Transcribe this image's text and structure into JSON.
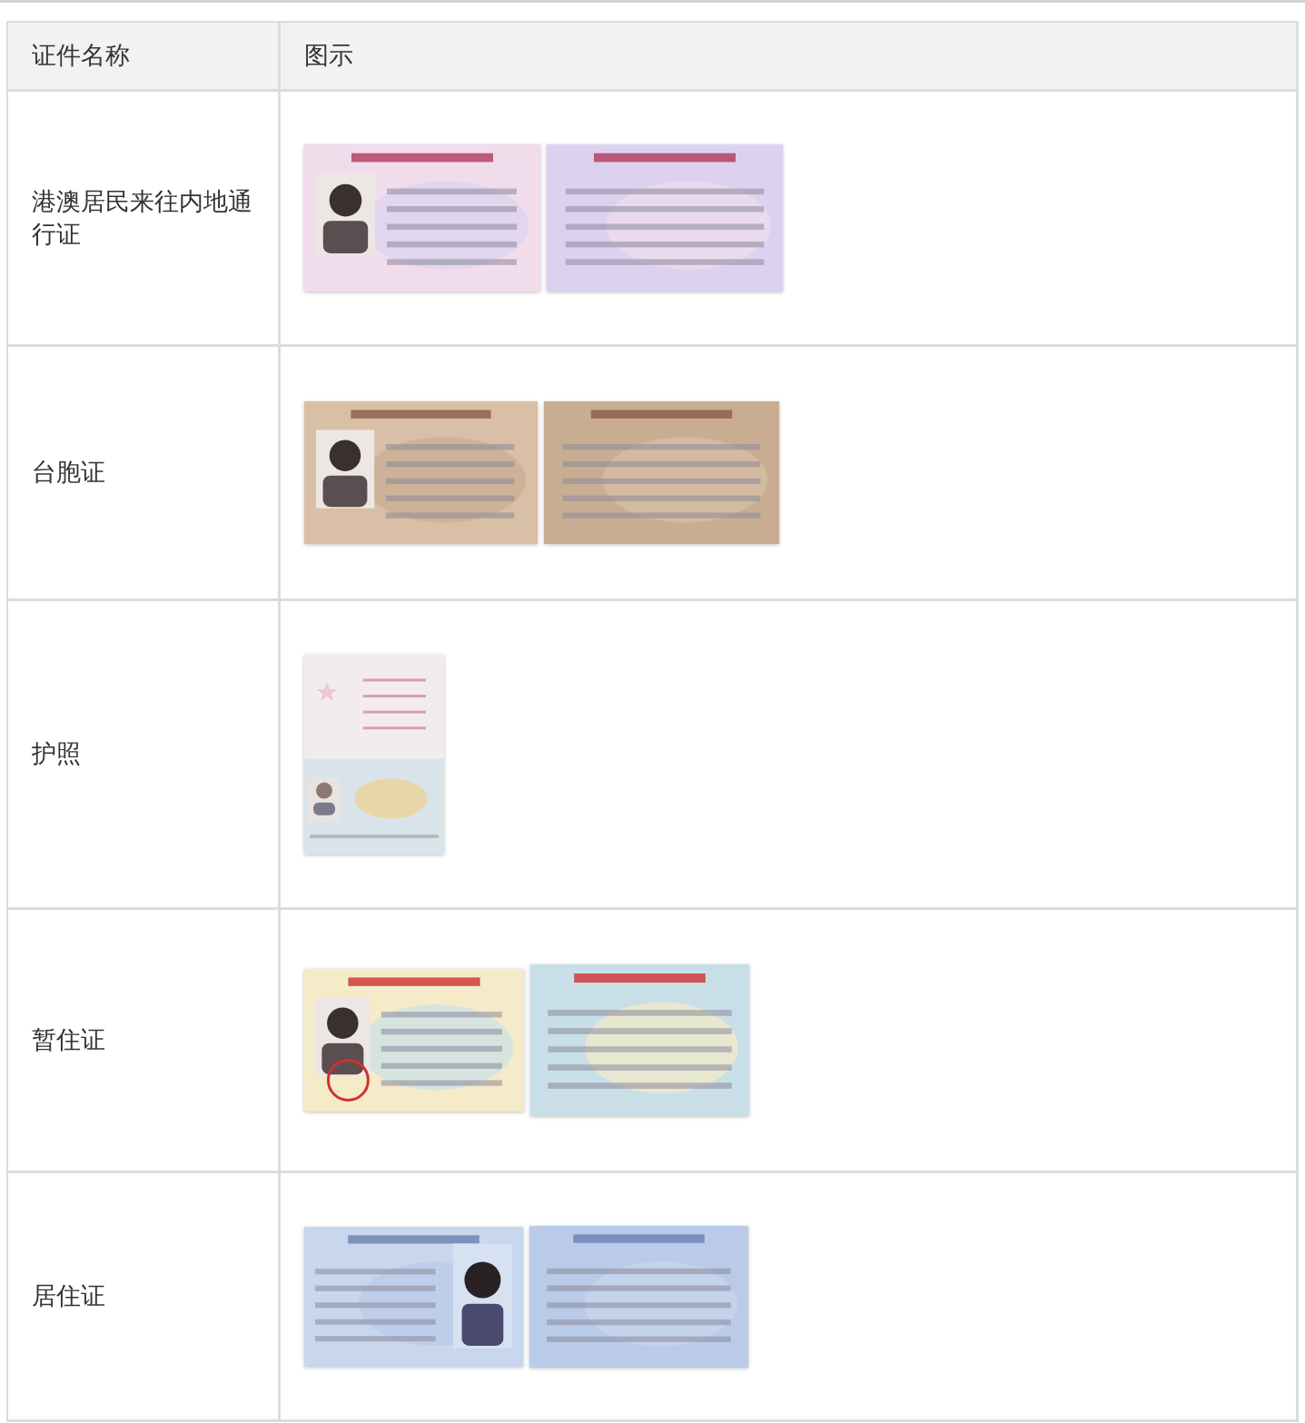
{
  "table": {
    "columns": [
      "证件名称",
      "图示"
    ],
    "rows": [
      {
        "name": "港澳居民来往内地通行证"
      },
      {
        "name": "台胞证"
      },
      {
        "name": "护照"
      },
      {
        "name": "暂住证"
      },
      {
        "name": "居住证"
      }
    ]
  }
}
